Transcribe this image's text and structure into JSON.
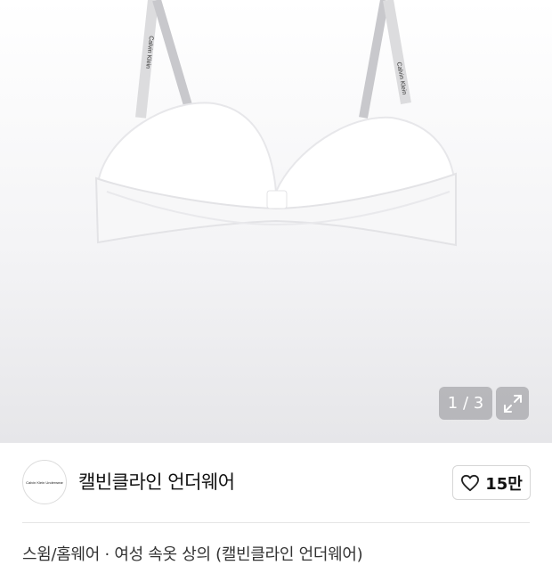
{
  "gallery": {
    "pager_text": "1 / 3",
    "expand_icon": "expand-arrows-icon",
    "strap_text": "Calvin Klein"
  },
  "brand": {
    "name": "캘빈클라인 언더웨어",
    "logo_text": "Calvin Klein Underwear"
  },
  "like": {
    "icon": "heart-outline-icon",
    "count": "15만"
  },
  "product": {
    "title_partial": "스윔/홈웨어 · 여성 속옷 상의 (캘빈클라인 언더웨어)"
  },
  "colors": {
    "hero_bg_top": "#ffffff",
    "hero_bg_bottom": "#e6e6e9",
    "pager_bg": "#96969b"
  }
}
